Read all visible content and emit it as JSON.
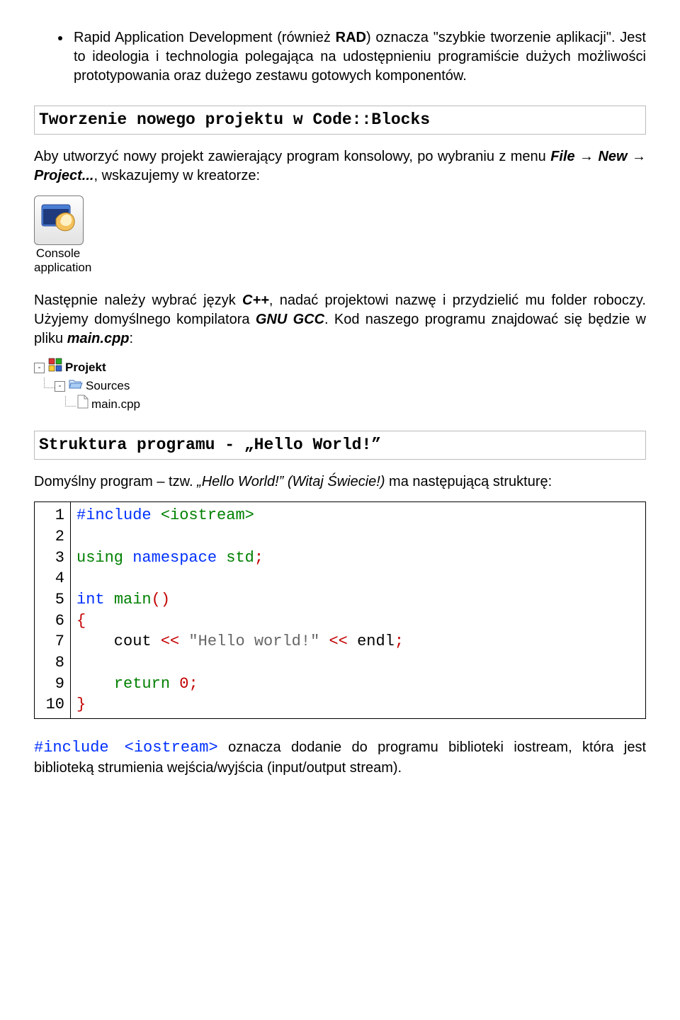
{
  "bullet": {
    "text_before_bold": "Rapid Application Development (również ",
    "bold": "RAD",
    "text_after_bold": ") oznacza \"szybkie tworzenie aplikacji\". Jest to ideologia i technologia polegająca na udostępnieniu programiście dużych możliwości prototypowania oraz dużego zestawu gotowych komponentów."
  },
  "section1": {
    "title": "Tworzenie nowego projektu w Code::Blocks",
    "p1_a": "Aby utworzyć nowy projekt zawierający program konsolowy, po wybraniu z menu ",
    "p1_file": "File",
    "p1_arrow1": " → ",
    "p1_new": "New",
    "p1_arrow2": " → ",
    "p1_project": "Project...",
    "p1_b": ", wskazujemy w kreatorze:",
    "icon_caption": "Console application",
    "p2_a": "Następnie należy wybrać język ",
    "p2_cpp": "C++",
    "p2_b": ", nadać projektowi nazwę i przydzielić mu folder roboczy. Użyjemy domyślnego kompilatora ",
    "p2_gcc": "GNU GCC",
    "p2_c": ". Kod naszego programu znajdować się będzie w pliku ",
    "p2_main": "main.cpp",
    "p2_d": ":",
    "tree": {
      "projekt": "Projekt",
      "sources": "Sources",
      "maincpp": "main.cpp"
    }
  },
  "section2": {
    "title": "Struktura programu - „Hello World!”",
    "p_a": "Domyślny program – tzw. ",
    "p_hello": "„Hello World!” (Witaj Świecie!)",
    "p_b": " ma następującą strukturę:"
  },
  "code": {
    "gutter": " 1\n 2\n 3\n 4\n 5\n 6\n 7\n 8\n 9\n10",
    "l1a": "#include ",
    "l1b": "<iostream>",
    "l3a": "using ",
    "l3b": "namespace ",
    "l3c": "std",
    "l3d": ";",
    "l5a": "int ",
    "l5b": "main",
    "l5c": "()",
    "l6": "{",
    "l7a": "    cout ",
    "l7b": "<<",
    "l7c": " \"Hello world!\" ",
    "l7d": "<<",
    "l7e": " endl",
    "l7f": ";",
    "l9a": "    ",
    "l9b": "return ",
    "l9c": "0",
    "l9d": ";",
    "l10": "}"
  },
  "footer": {
    "mono": "#include <iostream>",
    "text": " oznacza dodanie do programu biblioteki iostream, która jest biblioteką strumienia wejścia/wyjścia (input/output stream)."
  }
}
